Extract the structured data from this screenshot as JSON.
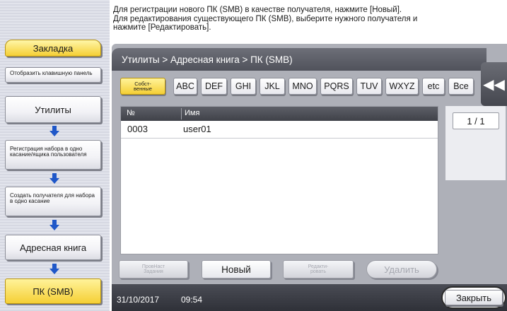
{
  "sidebar": {
    "bookmark_label": "Закладка",
    "show_keypad_label": "Отобразить клавишную панель",
    "utilities_label": "Утилиты",
    "one_touch_label": "Регистрация набора в одно касание/ящика пользователя",
    "create_dest_label": "Создать получателя для набора в одно касание",
    "address_book_label": "Адресная книга",
    "pc_smb_label": "ПК (SMB)"
  },
  "message": {
    "line1": "Для регистрации нового ПК (SMB) в качестве получателя, нажмите [Новый].",
    "line2": "Для редактирования существующего ПК (SMB), выберите нужного получателя и",
    "line3": "нажмите [Редактировать]."
  },
  "breadcrumb": "Утилиты > Адресная книга > ПК (SMB)",
  "tabs": [
    "Собст- венные",
    "ABC",
    "DEF",
    "GHI",
    "JKL",
    "MNO",
    "PQRS",
    "TUV",
    "WXYZ",
    "etc",
    "Все"
  ],
  "table": {
    "columns": [
      "№",
      "Имя"
    ],
    "rows": [
      {
        "no": "0003",
        "name": "user01"
      }
    ]
  },
  "page_counter": "1 / 1",
  "actions": {
    "check_job_label": "ПровНаст Задания",
    "new_label": "Новый",
    "edit_label": "Редакти- ровать",
    "delete_label": "Удалить"
  },
  "footer": {
    "date": "31/10/2017",
    "time": "09:54",
    "close_label": "Закрыть"
  },
  "colors": {
    "active_tab": "#f5cf35",
    "active_sidebar": "#f5cf35",
    "arrow": "#1f57c8",
    "panel_gray": "#aeb0b8",
    "footer": "#2f3138"
  },
  "icons": [
    "arrow-down-icon",
    "collapse-double-chevron-icon"
  ]
}
